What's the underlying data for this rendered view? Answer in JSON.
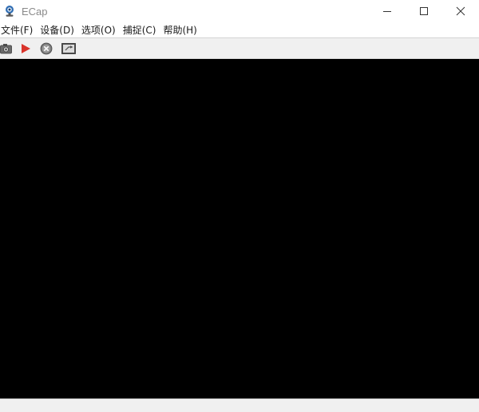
{
  "window": {
    "title": "ECap",
    "app_icon": "webcam-icon",
    "caption_buttons": [
      "minimize-icon",
      "maximize-icon",
      "close-icon"
    ]
  },
  "menu": {
    "items": [
      {
        "label": "文件(F)"
      },
      {
        "label": "设备(D)"
      },
      {
        "label": "选项(O)"
      },
      {
        "label": "捕捉(C)"
      },
      {
        "label": "帮助(H)"
      }
    ]
  },
  "toolbar": {
    "buttons": [
      "camera-snapshot-icon",
      "play-icon",
      "stop-icon",
      "fullscreen-icon"
    ]
  },
  "colors": {
    "viewport": "#000000",
    "toolbar": "#f0f0f0",
    "play": "#d9342b"
  }
}
